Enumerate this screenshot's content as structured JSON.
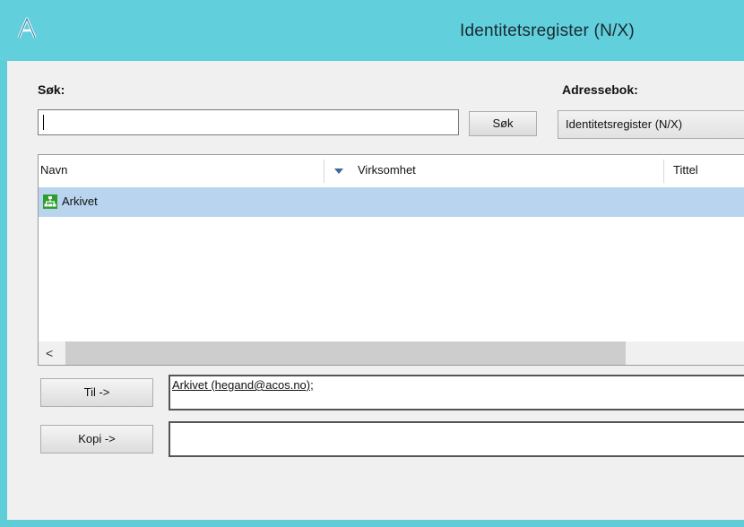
{
  "window": {
    "title": "Identitetsregister (N/X)",
    "app_icon": "letter-a-icon"
  },
  "search": {
    "label": "Søk:",
    "value": "",
    "button_label": "Søk"
  },
  "addressbook": {
    "label": "Adressebok:",
    "selected": "Identitetsregister (N/X)"
  },
  "list": {
    "columns": [
      "Navn",
      "Virksomhet",
      "Tittel"
    ],
    "rows": [
      {
        "name": "Arkivet",
        "company": "",
        "title": "",
        "icon": "organization-icon",
        "selected": true
      }
    ],
    "scroll_left_icon": "<"
  },
  "recipients": {
    "to_button": "Til ->",
    "to_value": "Arkivet (hegand@acos.no);",
    "cc_button": "Kopi ->",
    "cc_value": ""
  },
  "colors": {
    "titlebar": "#62d0dc",
    "selection": "#b8d4ee",
    "icon_green": "#2e9e2e"
  }
}
